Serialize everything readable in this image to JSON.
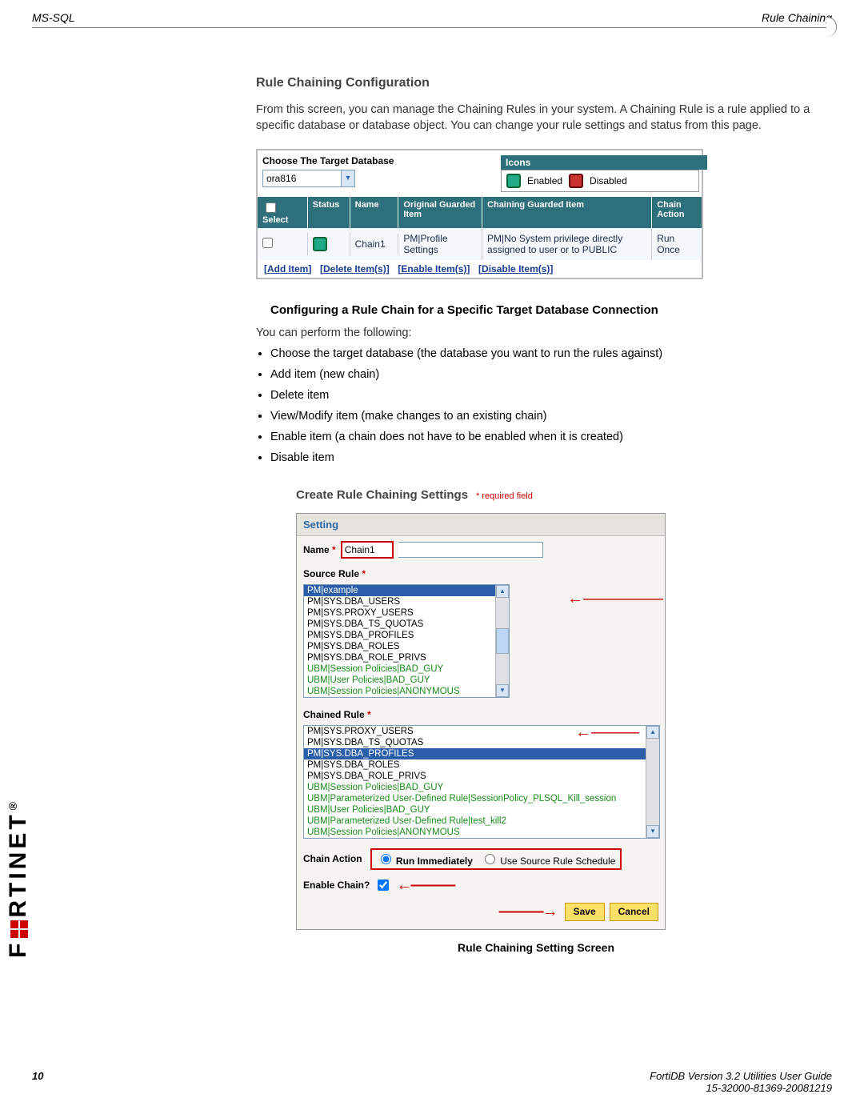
{
  "header": {
    "left": "MS-SQL",
    "right": "Rule Chaining"
  },
  "section1": {
    "title": "Rule Chaining Configuration",
    "desc": "From this screen, you can manage the Chaining Rules in your system. A Chaining Rule is a rule applied to a specific database or database object. You can change your  rule settings and status from this page."
  },
  "ui1": {
    "choose_label": "Choose The Target Database",
    "db_value": "ora816",
    "icons_hdr": "Icons",
    "enabled": "Enabled",
    "disabled": "Disabled",
    "cols": {
      "sel": "Select",
      "status": "Status",
      "name": "Name",
      "orig": "Original Guarded Item",
      "guard": "Chaining Guarded Item",
      "act": "Chain Action"
    },
    "row": {
      "name": "Chain1",
      "orig": "PM|Profile Settings",
      "guard": "PM|No System privilege directly assigned to user or to PUBLIC",
      "act": "Run Once"
    },
    "links": {
      "add": "[Add Item]",
      "del": "[Delete Item(s)]",
      "en": "[Enable Item(s)]",
      "dis": "[Disable Item(s)]"
    }
  },
  "subhead": "Configuring a Rule Chain for a Specific Target Database Connection",
  "intro": "You can perform the following:",
  "bullets": [
    "Choose the target database (the database you want to run the rules against)",
    "Add item (new chain)",
    "Delete item",
    "View/Modify item (make changes to an existing chain)",
    "Enable item (a chain does not have to be enabled when it is created)",
    "Disable item"
  ],
  "create": {
    "title": "Create Rule Chaining Settings",
    "req": "* required field",
    "setting_hdr": "Setting",
    "name_lbl": "Name",
    "name_val": "Chain1",
    "source_lbl": "Source Rule",
    "source_items": [
      {
        "t": "PM|example",
        "sel": true
      },
      {
        "t": "PM|SYS.DBA_USERS"
      },
      {
        "t": "PM|SYS.PROXY_USERS"
      },
      {
        "t": "PM|SYS.DBA_TS_QUOTAS"
      },
      {
        "t": "PM|SYS.DBA_PROFILES"
      },
      {
        "t": "PM|SYS.DBA_ROLES"
      },
      {
        "t": "PM|SYS.DBA_ROLE_PRIVS"
      },
      {
        "t": "UBM|Session Policies|BAD_GUY",
        "g": true
      },
      {
        "t": "UBM|User Policies|BAD_GUY",
        "g": true
      },
      {
        "t": "UBM|Session Policies|ANONYMOUS",
        "g": true
      }
    ],
    "chained_lbl": "Chained Rule",
    "chained_items": [
      {
        "t": "PM|SYS.PROXY_USERS"
      },
      {
        "t": "PM|SYS.DBA_TS_QUOTAS"
      },
      {
        "t": "PM|SYS.DBA_PROFILES",
        "sel": true
      },
      {
        "t": "PM|SYS.DBA_ROLES"
      },
      {
        "t": "PM|SYS.DBA_ROLE_PRIVS"
      },
      {
        "t": "UBM|Session Policies|BAD_GUY",
        "g": true
      },
      {
        "t": "UBM|Parameterized User-Defined Rule|SessionPolicy_PLSQL_Kill_session",
        "g": true
      },
      {
        "t": "UBM|User Policies|BAD_GUY",
        "g": true
      },
      {
        "t": "UBM|Parameterized User-Defined Rule|test_kill2",
        "g": true
      },
      {
        "t": "UBM|Session Policies|ANONYMOUS",
        "g": true
      }
    ],
    "chain_action_lbl": "Chain Action",
    "run_now": "Run Immediately",
    "use_sched": "Use Source Rule Schedule",
    "enable_lbl": "Enable Chain?",
    "save": "Save",
    "cancel": "Cancel"
  },
  "caption2": "Rule Chaining Setting Screen",
  "footer": {
    "page": "10",
    "r1": "FortiDB Version 3.2 Utilities  User Guide",
    "r2": "15-32000-81369-20081219"
  },
  "logo_text": "F   RTINET"
}
